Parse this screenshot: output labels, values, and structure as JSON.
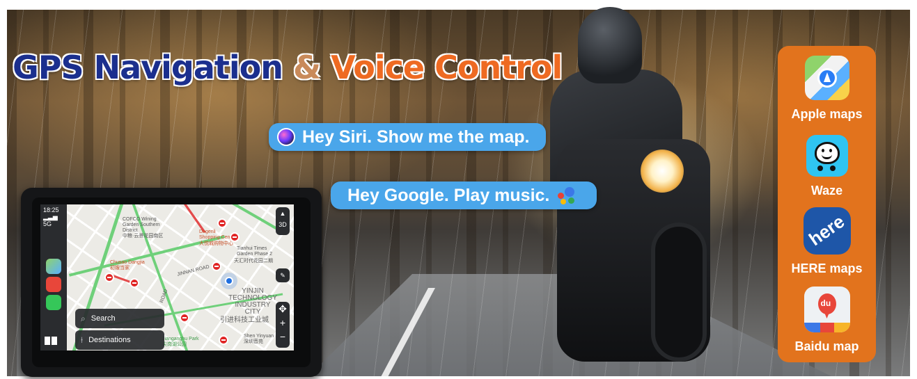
{
  "headline": {
    "part1": "GPS Navigation",
    "amp": " & ",
    "part2": "Voice Control"
  },
  "bubbles": {
    "siri": {
      "text": "Hey Siri. Show me the map.",
      "icon": "siri-icon"
    },
    "google": {
      "text": "Hey Google. Play music.",
      "icon": "google-assistant-icon"
    }
  },
  "apps": [
    {
      "label": "Apple maps",
      "icon": "apple-maps-icon"
    },
    {
      "label": "Waze",
      "icon": "waze-icon"
    },
    {
      "label": "HERE maps",
      "icon": "here-maps-icon",
      "glyph": "here"
    },
    {
      "label": "Baidu map",
      "icon": "baidu-map-icon",
      "glyph": "du"
    }
  ],
  "device": {
    "status": {
      "time": "18:25",
      "signal": "5G"
    },
    "map": {
      "labels": [
        "COFCO Wining\nGarden Southern\nDistrict",
        "中粮·云景花园南区",
        "Dagenli\nShopping Centre",
        "大悦城购物中心",
        "Tianhui Times\nGarden Phase 2",
        "天汇时代花园二期",
        "Chusao Dangjia",
        "初嫂当家",
        "JINNAN ROAD",
        "YINJIN\nTECHNOLOGY\nINDUSTRY\nCITY",
        "引进科技工业城",
        "ROAD",
        "Jianganghu Park",
        "尖岗湖公园",
        "Shen Yinyuan\n深圳音苑"
      ]
    },
    "panel": {
      "search": "Search",
      "destinations": "Destinations"
    },
    "controls": {
      "three_d": "3D",
      "plus": "+",
      "minus": "−"
    }
  },
  "colors": {
    "headline_blue": "#1b2f8e",
    "headline_orange": "#ee6a22",
    "bubble": "#4aa6ea",
    "app_panel": "#e2731d"
  }
}
